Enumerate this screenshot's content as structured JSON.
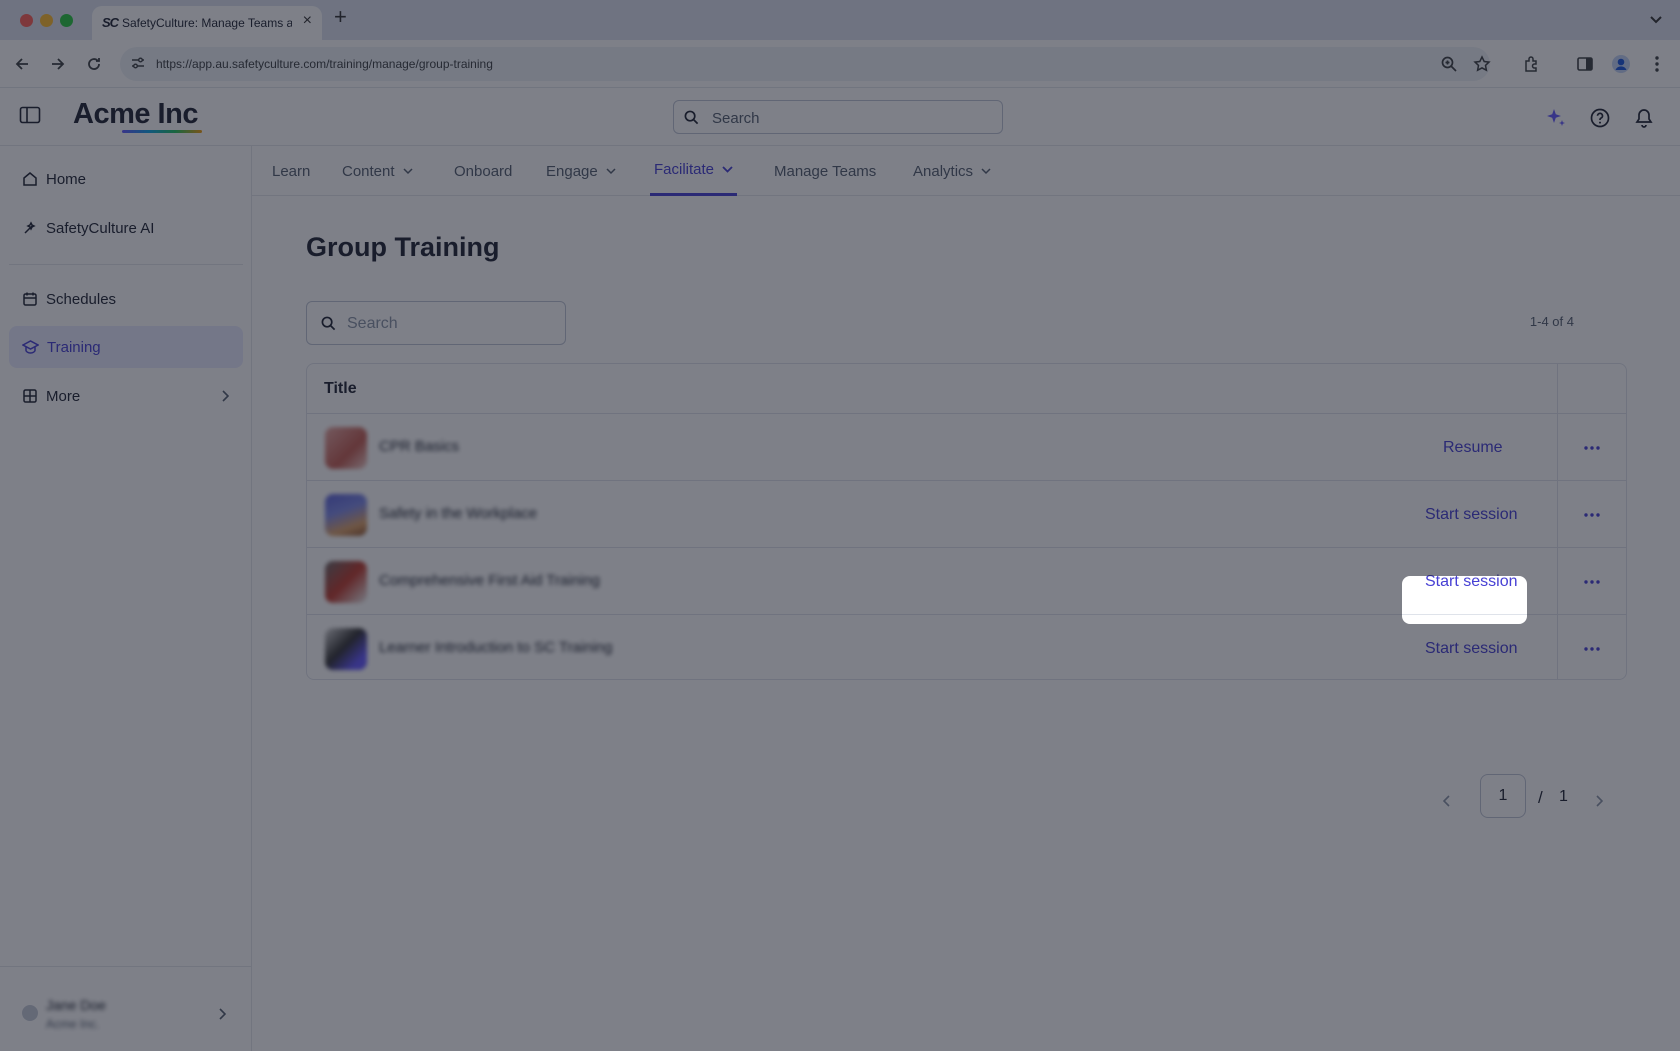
{
  "browser": {
    "tab_favicon": "SC",
    "tab_title": "SafetyCulture: Manage Teams and...",
    "url": "https://app.au.safetyculture.com/training/manage/group-training"
  },
  "header": {
    "logo": "Acme Inc",
    "search_placeholder": "Search"
  },
  "sidebar": {
    "items": [
      {
        "label": "Home",
        "icon": "home-icon"
      },
      {
        "label": "SafetyCulture AI",
        "icon": "ai-icon"
      },
      {
        "label": "Schedules",
        "icon": "calendar-icon"
      },
      {
        "label": "Training",
        "icon": "graduation-cap-icon"
      },
      {
        "label": "More",
        "icon": "grid-icon"
      }
    ],
    "user": {
      "name": "Jane Doe",
      "org": "Acme Inc."
    }
  },
  "subnav": {
    "items": [
      {
        "label": "Learn"
      },
      {
        "label": "Content"
      },
      {
        "label": "Onboard"
      },
      {
        "label": "Engage"
      },
      {
        "label": "Facilitate"
      },
      {
        "label": "Manage Teams"
      },
      {
        "label": "Analytics"
      }
    ],
    "active": "Facilitate"
  },
  "page": {
    "title": "Group Training",
    "search_placeholder": "Search",
    "count": "1-4 of 4",
    "table_header": "Title",
    "rows": [
      {
        "title": "CPR Basics",
        "action": "Resume"
      },
      {
        "title": "Safety in the Workplace",
        "action": "Start session"
      },
      {
        "title": "Comprehensive First Aid Training",
        "action": "Start session"
      },
      {
        "title": "Learner Introduction to SC Training",
        "action": "Start session"
      }
    ],
    "pager": {
      "current": "1",
      "separator": "/",
      "total": "1"
    }
  },
  "colors": {
    "accent": "#4740d4",
    "active_bg": "#e9eaff"
  }
}
